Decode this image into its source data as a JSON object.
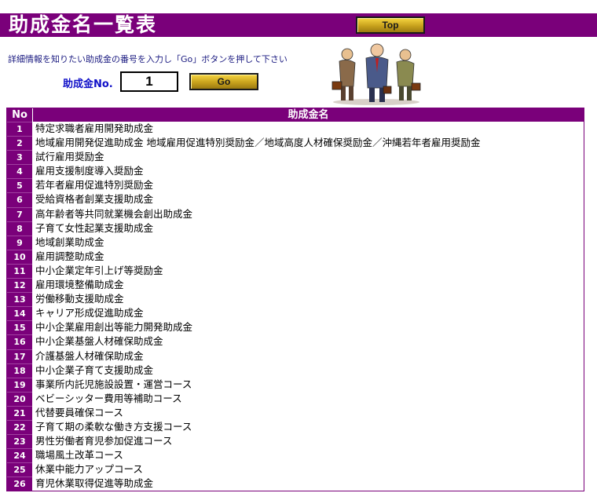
{
  "page": {
    "title": "助成金名一覧表",
    "top_button": "Top",
    "instruction": "詳細情報を知りたい助成金の番号を入力し「Go」ボタンを押して下さい",
    "no_label": "助成金No.",
    "no_value": "1",
    "go_button": "Go"
  },
  "table": {
    "headers": {
      "no": "No",
      "name": "助成金名"
    },
    "rows": [
      {
        "no": "1",
        "name": "特定求職者雇用開発助成金"
      },
      {
        "no": "2",
        "name": "地域雇用開発促進助成金 地域雇用促進特別奨励金／地域高度人材確保奨励金／沖縄若年者雇用奨励金"
      },
      {
        "no": "3",
        "name": "試行雇用奨励金"
      },
      {
        "no": "4",
        "name": "雇用支援制度導入奨励金"
      },
      {
        "no": "5",
        "name": "若年者雇用促進特別奨励金"
      },
      {
        "no": "6",
        "name": "受給資格者創業支援助成金"
      },
      {
        "no": "7",
        "name": "高年齢者等共同就業機会創出助成金"
      },
      {
        "no": "8",
        "name": "子育て女性起業支援助成金"
      },
      {
        "no": "9",
        "name": "地域創業助成金"
      },
      {
        "no": "10",
        "name": "雇用調整助成金"
      },
      {
        "no": "11",
        "name": "中小企業定年引上げ等奨励金"
      },
      {
        "no": "12",
        "name": "雇用環境整備助成金"
      },
      {
        "no": "13",
        "name": "労働移動支援助成金"
      },
      {
        "no": "14",
        "name": "キャリア形成促進助成金"
      },
      {
        "no": "15",
        "name": "中小企業雇用創出等能力開発助成金"
      },
      {
        "no": "16",
        "name": "中小企業基盤人材確保助成金"
      },
      {
        "no": "17",
        "name": "介護基盤人材確保助成金"
      },
      {
        "no": "18",
        "name": "中小企業子育て支援助成金"
      },
      {
        "no": "19",
        "name": "事業所内託児施設設置・運営コース"
      },
      {
        "no": "20",
        "name": "ベビーシッター費用等補助コース"
      },
      {
        "no": "21",
        "name": "代替要員確保コース"
      },
      {
        "no": "22",
        "name": "子育て期の柔軟な働き方支援コース"
      },
      {
        "no": "23",
        "name": "男性労働者育児参加促進コース"
      },
      {
        "no": "24",
        "name": "職場風土改革コース"
      },
      {
        "no": "25",
        "name": "休業中能力アップコース"
      },
      {
        "no": "26",
        "name": "育児休業取得促進等助成金"
      }
    ]
  }
}
